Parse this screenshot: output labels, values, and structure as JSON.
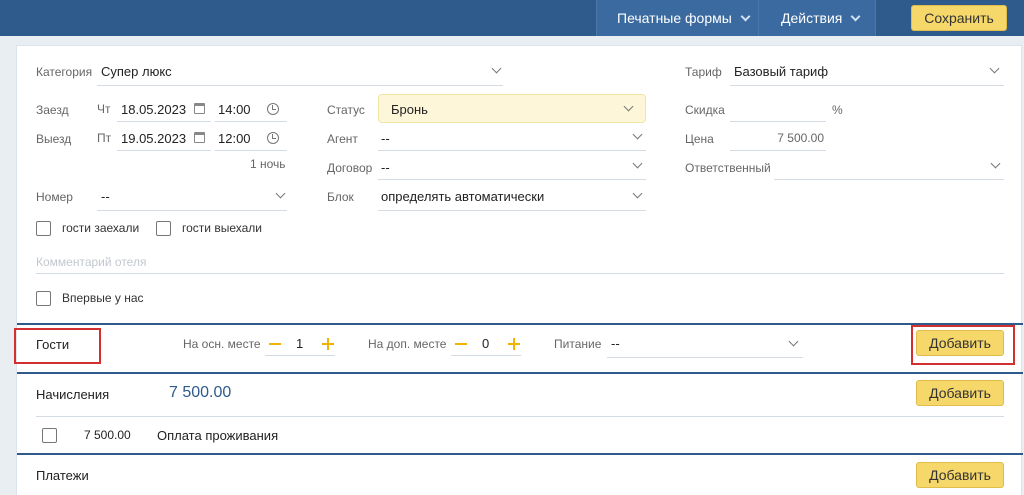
{
  "topbar": {
    "print_forms": "Печатные формы",
    "actions": "Действия",
    "save": "Сохранить"
  },
  "form": {
    "category_label": "Категория",
    "category_value": "Супер люкс",
    "tariff_label": "Тариф",
    "tariff_value": "Базовый тариф",
    "checkin_label": "Заезд",
    "checkin_day": "Чт",
    "checkin_date": "18.05.2023",
    "checkin_time": "14:00",
    "checkout_label": "Выезд",
    "checkout_day": "Пт",
    "checkout_date": "19.05.2023",
    "checkout_time": "12:00",
    "nights": "1 ночь",
    "status_label": "Статус",
    "status_value": "Бронь",
    "agent_label": "Агент",
    "agent_value": "--",
    "contract_label": "Договор",
    "contract_value": "--",
    "block_label": "Блок",
    "block_value": "определять автоматически",
    "discount_label": "Скидка",
    "discount_value": "",
    "discount_unit": "%",
    "price_label": "Цена",
    "price_value": "7 500.00",
    "responsible_label": "Ответственный",
    "responsible_value": "",
    "room_label": "Номер",
    "room_value": "--",
    "guests_checked_in": "гости заехали",
    "guests_checked_out": "гости выехали",
    "comment_placeholder": "Комментарий отеля",
    "first_time": "Впервые у нас"
  },
  "guests": {
    "title": "Гости",
    "main_place_label": "На осн. месте",
    "main_place_value": "1",
    "extra_place_label": "На доп. месте",
    "extra_place_value": "0",
    "meal_label": "Питание",
    "meal_value": "--",
    "add": "Добавить"
  },
  "charges": {
    "title": "Начисления",
    "total": "7 500.00",
    "add": "Добавить",
    "rows": [
      {
        "amount": "7 500.00",
        "description": "Оплата проживания"
      }
    ]
  },
  "payments": {
    "title": "Платежи",
    "add": "Добавить"
  },
  "colors": {
    "brand": "#2e5a8c",
    "accent_button": "#f5d76a",
    "highlight_box": "#d32f2f",
    "stepper": "#f0b400"
  }
}
